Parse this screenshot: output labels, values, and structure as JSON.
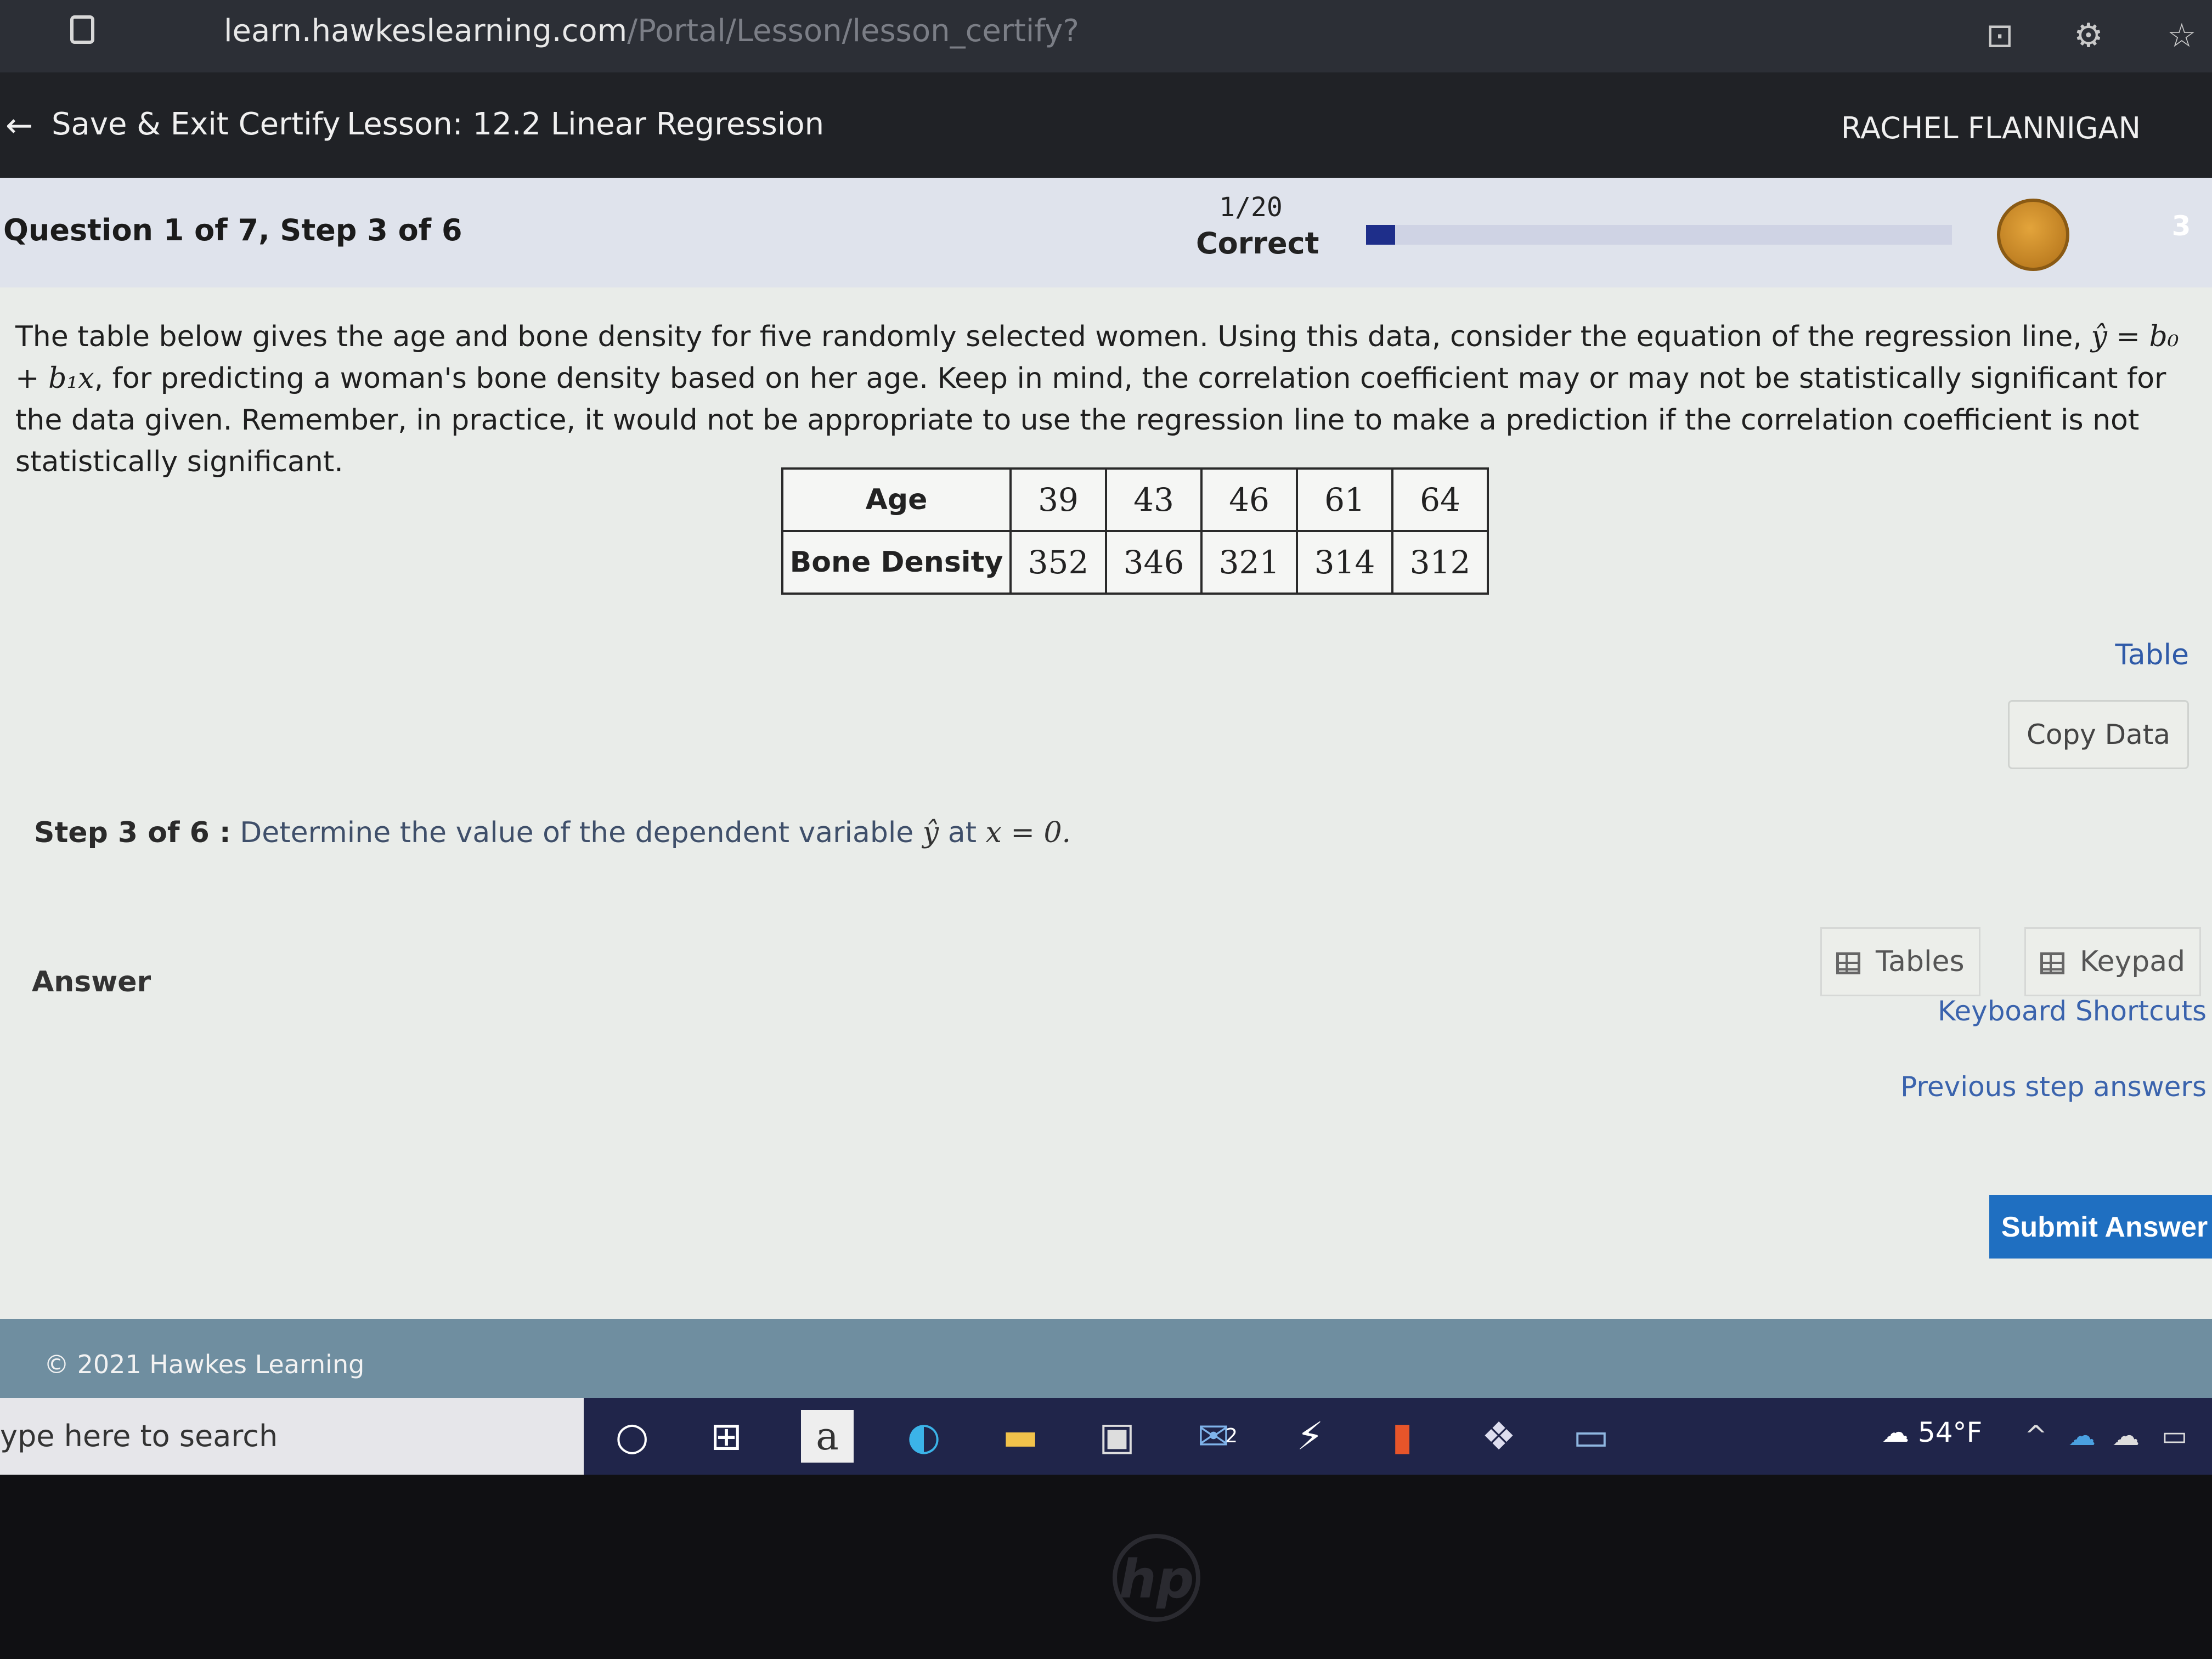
{
  "browser": {
    "url_domain": "learn.hawkeslearning.com",
    "url_path": "/Portal/Lesson/lesson_certify?"
  },
  "header": {
    "save_exit_label": "Save & Exit Certify",
    "lesson_label": "Lesson: 12.2 Linear Regression",
    "user_name": "RACHEL FLANNIGAN"
  },
  "question_bar": {
    "title": "Question 1 of 7, Step 3 of 6",
    "score": "1/20",
    "score_label": "Correct",
    "progress_fraction": 0.05,
    "lives": "3"
  },
  "problem": {
    "intro": "The table below gives the age and bone density for five randomly selected women. Using this data, consider the equation of the regression line, ",
    "equation": "ŷ = b₀ + b₁x",
    "continuation": ", for predicting a woman's bone density based on her age. Keep in mind, the correlation coefficient may or may not be statistically significant for the data given. Remember, in practice, it would not be appropriate to use the regression line to make a prediction if the correlation coefficient is not statistically significant."
  },
  "table": {
    "rows": [
      {
        "header": "Age",
        "values": [
          "39",
          "43",
          "46",
          "61",
          "64"
        ]
      },
      {
        "header": "Bone Density",
        "values": [
          "352",
          "346",
          "321",
          "314",
          "312"
        ]
      }
    ],
    "table_link": "Table",
    "copy_label": "Copy Data"
  },
  "step": {
    "label": "Step 3 of 6 :",
    "text": "Determine the value of the dependent variable ",
    "var": "ŷ",
    "text2": " at ",
    "condition": "x = 0."
  },
  "answer": {
    "label": "Answer",
    "tables_label": "Tables",
    "keypad_label": "Keypad",
    "keyboard_shortcuts": "Keyboard Shortcuts",
    "previous_answers": "Previous step answers",
    "submit_label": "Submit Answer"
  },
  "footer": {
    "copyright": "© 2021 Hawkes Learning"
  },
  "taskbar": {
    "search_placeholder": "ype here to search",
    "temperature": "54°F",
    "mail_badge": "2"
  }
}
